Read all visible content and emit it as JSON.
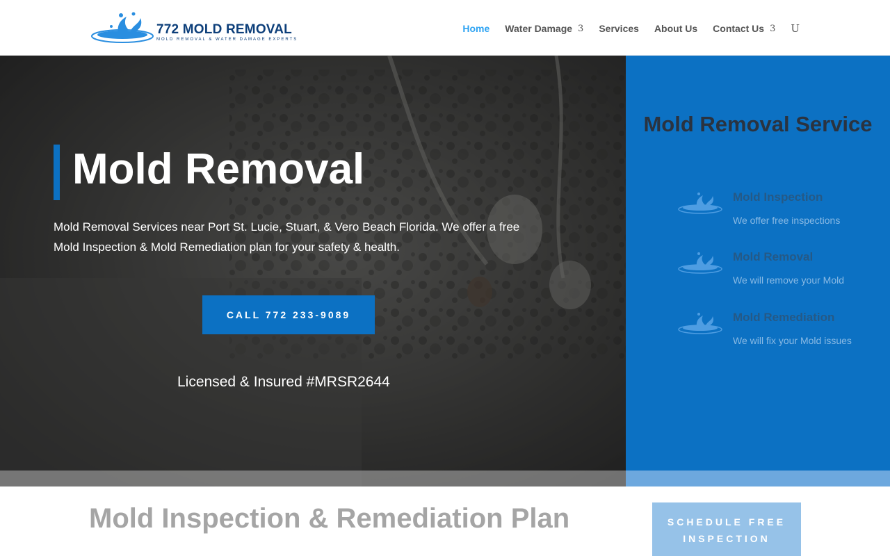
{
  "brand": {
    "title": "772 MOLD REMOVAL",
    "tagline": "Mold Removal & Water Damage Experts",
    "color": "#0d3f7a",
    "logo_icon": "water-splash-icon"
  },
  "nav": {
    "home": "Home",
    "water_damage": "Water Damage",
    "services": "Services",
    "about": "About Us",
    "contact": "Contact Us",
    "caret_glyph": "3",
    "search_glyph": "U",
    "active_color": "#2ea3f2"
  },
  "hero": {
    "title": "Mold Removal",
    "description": "Mold Removal Services near Port St. Lucie, Stuart, & Vero Beach Florida.  We offer a free Mold Inspection & Mold Remediation plan for your safety & health.",
    "cta": "CALL 772 233-9089",
    "licensed": "Licensed & Insured #MRSR2644",
    "accent": "#0c71c3"
  },
  "side": {
    "title": "Mold Removal Service",
    "services": [
      {
        "name": "Mold Inspection",
        "desc": "We offer free inspections",
        "icon": "water-splash-icon"
      },
      {
        "name": "Mold Removal",
        "desc": "We will remove your Mold",
        "icon": "water-splash-icon"
      },
      {
        "name": "Mold Remediation",
        "desc": "We will fix your Mold issues",
        "icon": "water-splash-icon"
      }
    ]
  },
  "lower": {
    "title": "Mold Inspection & Remediation Plan",
    "schedule_btn": "SCHEDULE FREE INSPECTION"
  }
}
